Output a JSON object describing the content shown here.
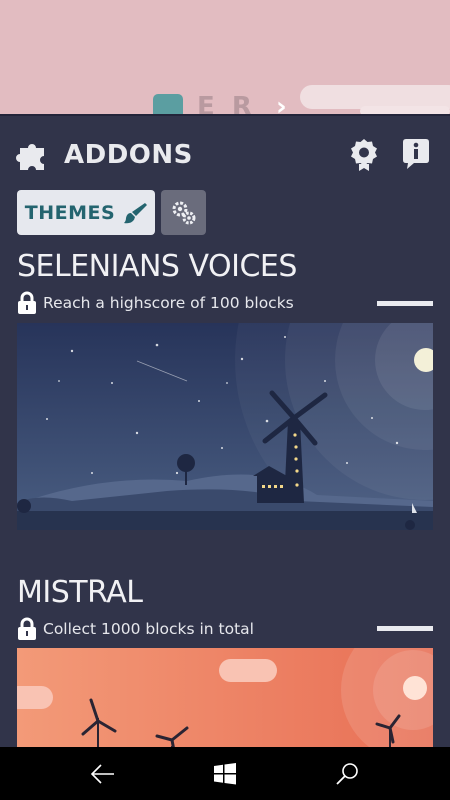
{
  "game_top": {
    "logo_text": "E R",
    "chevron": "›",
    "colors": {
      "background": "#e2bcc1",
      "teal_block": "#5b9ea1"
    }
  },
  "header": {
    "title": "ADDONS",
    "icons": [
      "puzzle-icon",
      "badge-icon",
      "info-bubble-icon"
    ]
  },
  "tabs": [
    {
      "label": "THEMES",
      "icon": "brush-icon",
      "selected": true
    },
    {
      "label": "",
      "icon": "gears-icon",
      "selected": false
    }
  ],
  "themes": [
    {
      "name": "SELENIANS VOICES",
      "requirement": "Reach a highscore of 100 blocks",
      "locked": true,
      "progress": 0,
      "preview": "night-windmill-scene"
    },
    {
      "name": "MISTRAL",
      "requirement": "Collect 1000 blocks in total",
      "locked": true,
      "progress": 0,
      "preview": "sunset-wind-turbines-scene"
    }
  ],
  "navbar": {
    "buttons": [
      "back-arrow-icon",
      "windows-icon",
      "search-icon"
    ]
  },
  "colors": {
    "panel": "#31344a",
    "accent_teal": "#24646f",
    "night_sky": "#2a3557",
    "sunset": "#ef8f6e"
  }
}
